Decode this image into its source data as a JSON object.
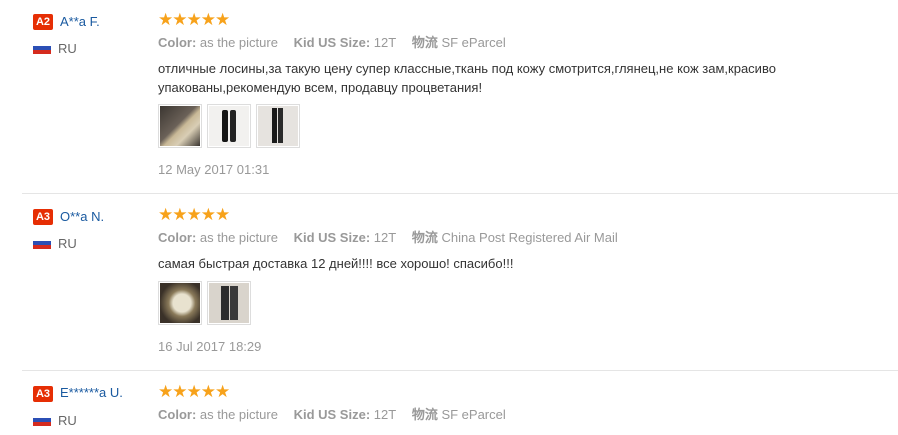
{
  "reviews": [
    {
      "level": "A2",
      "name": "A**a F.",
      "country": "RU",
      "stars": "★★★★★",
      "color_label": "Color:",
      "color_value": "as the picture",
      "size_label": "Kid US Size:",
      "size_value": "12T",
      "ship_label": "物流",
      "ship_value": "SF eParcel",
      "text": "отличные лосины,за такую цену супер классные,ткань под кожу смотрится,глянец,не кож зам,красиво упакованы,рекомендую всем, продавцу процветания!",
      "date": "12 May 2017 01:31"
    },
    {
      "level": "A3",
      "name": "O**a N.",
      "country": "RU",
      "stars": "★★★★★",
      "color_label": "Color:",
      "color_value": "as the picture",
      "size_label": "Kid US Size:",
      "size_value": "12T",
      "ship_label": "物流",
      "ship_value": "China Post Registered Air Mail",
      "text": "самая быстрая доставка 12 дней!!!! все хорошо! спасибо!!!",
      "date": "16 Jul 2017 18:29"
    },
    {
      "level": "A3",
      "name": "E******a U.",
      "country": "RU",
      "stars": "★★★★★",
      "color_label": "Color:",
      "color_value": "as the picture",
      "size_label": "Kid US Size:",
      "size_value": "12T",
      "ship_label": "物流",
      "ship_value": "SF eParcel"
    }
  ],
  "colors": {
    "badge": "#e62e04",
    "star": "#f7a21b",
    "name": "#1a5aa0"
  }
}
